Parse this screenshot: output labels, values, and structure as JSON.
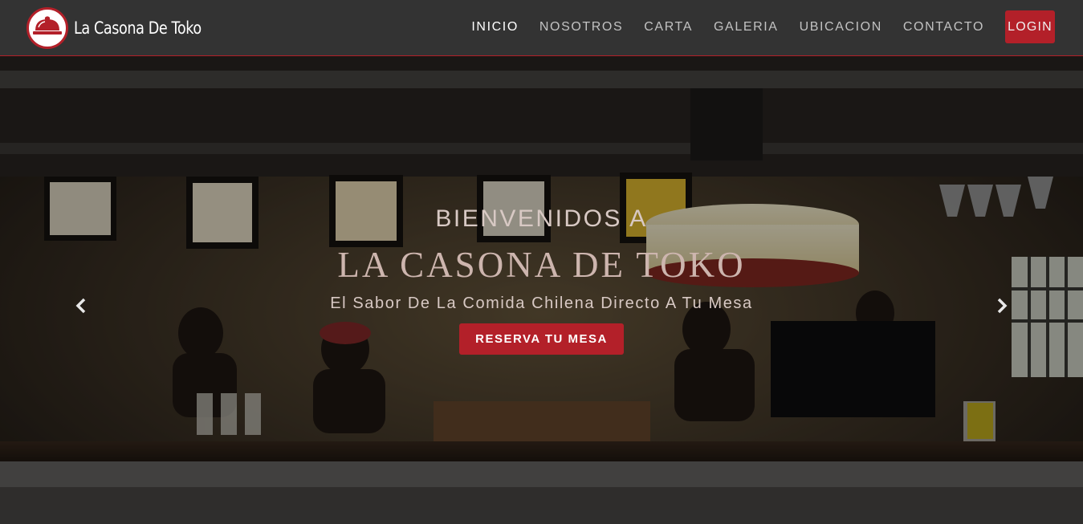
{
  "brand": {
    "name": "La Casona De Toko",
    "logo_icon": "cloche-icon"
  },
  "nav": {
    "items": [
      {
        "label": "INICIO",
        "active": true
      },
      {
        "label": "NOSOTROS",
        "active": false
      },
      {
        "label": "CARTA",
        "active": false
      },
      {
        "label": "GALERIA",
        "active": false
      },
      {
        "label": "UBICACION",
        "active": false
      },
      {
        "label": "CONTACTO",
        "active": false
      }
    ],
    "login_label": "LOGIN"
  },
  "hero": {
    "eyebrow": "BIENVENIDOS A",
    "title": "LA CASONA DE TOKO",
    "subtitle": "El Sabor De La Comida Chilena Directo A Tu Mesa",
    "cta_label": "RESERVA TU MESA",
    "prev_icon": "chevron-left-icon",
    "next_icon": "chevron-right-icon"
  },
  "colors": {
    "accent": "#b32029",
    "navbar": "#333333",
    "nav_text": "#c2c2c2",
    "nav_active": "#ffffff"
  }
}
